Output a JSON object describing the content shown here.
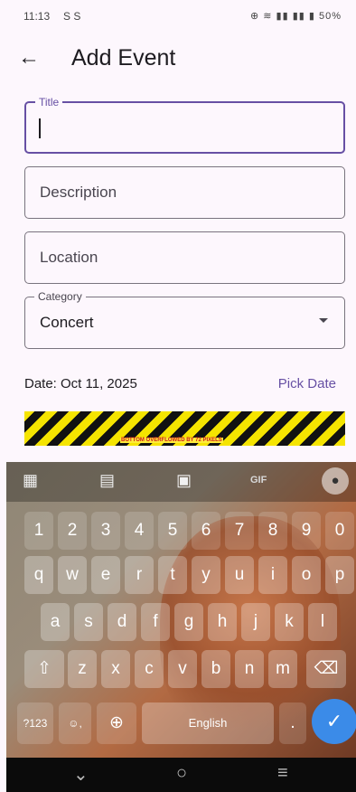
{
  "status": {
    "time": "11:13",
    "left_icons": "S S",
    "battery": "50%"
  },
  "appbar": {
    "back_icon": "←",
    "title": "Add Event"
  },
  "form": {
    "title": {
      "label": "Title",
      "value": ""
    },
    "description": {
      "placeholder": "Description"
    },
    "location": {
      "placeholder": "Location"
    },
    "category": {
      "label": "Category",
      "value": "Concert"
    },
    "date": {
      "label": "Date: Oct 11, 2025",
      "pick": "Pick Date"
    },
    "overflow_message": "BOTTOM OVERFLOWED BY 72 PIXELS"
  },
  "keyboard": {
    "numbers": [
      "1",
      "2",
      "3",
      "4",
      "5",
      "6",
      "7",
      "8",
      "9",
      "0"
    ],
    "row1": [
      "q",
      "w",
      "e",
      "r",
      "t",
      "y",
      "u",
      "i",
      "o",
      "p"
    ],
    "row2": [
      "a",
      "s",
      "d",
      "f",
      "g",
      "h",
      "j",
      "k",
      "l"
    ],
    "row3": [
      "z",
      "x",
      "c",
      "v",
      "b",
      "n",
      "m"
    ],
    "mode_key": "?123",
    "space": "English",
    "period": ".",
    "gif": "GIF"
  },
  "colors": {
    "primary": "#6750a4",
    "background": "#fdf7fd",
    "enter_key": "#3b8be8"
  }
}
